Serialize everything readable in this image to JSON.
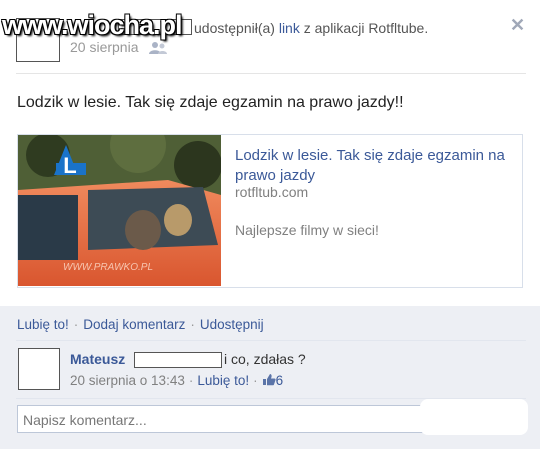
{
  "watermark": "www.wiocha.pl",
  "header": {
    "shared_text": "udostępnił(a)",
    "link_word": "link",
    "via_text": "z aplikacji Rotfltube.",
    "date": "20 sierpnia",
    "privacy_icon": "friends-icon",
    "close_icon": "close-icon",
    "close_glyph": "✕"
  },
  "status": "Lodzik w lesie. Tak się zdaje egzamin na prawo jazdy!!",
  "attachment": {
    "title": "Lodzik w lesie. Tak się zdaje egzamin na prawo jazdy",
    "domain": "rotfltub.com",
    "description": "Najlepsze filmy w sieci!",
    "thumb_text": "WWW.PRAWKO.PL",
    "thumb_sign": "L"
  },
  "actions": {
    "like": "Lubię to!",
    "comment": "Dodaj komentarz",
    "share": "Udostępnij",
    "separator": "·"
  },
  "comment": {
    "author": "Mateusz",
    "text": "i co, zdałas ?",
    "date": "20 sierpnia o 13:43",
    "like": "Lubię to!",
    "like_count": "6"
  },
  "comment_input": {
    "placeholder": "Napisz komentarz..."
  },
  "colors": {
    "link": "#3b5998",
    "action_bg": "#edeff4"
  }
}
